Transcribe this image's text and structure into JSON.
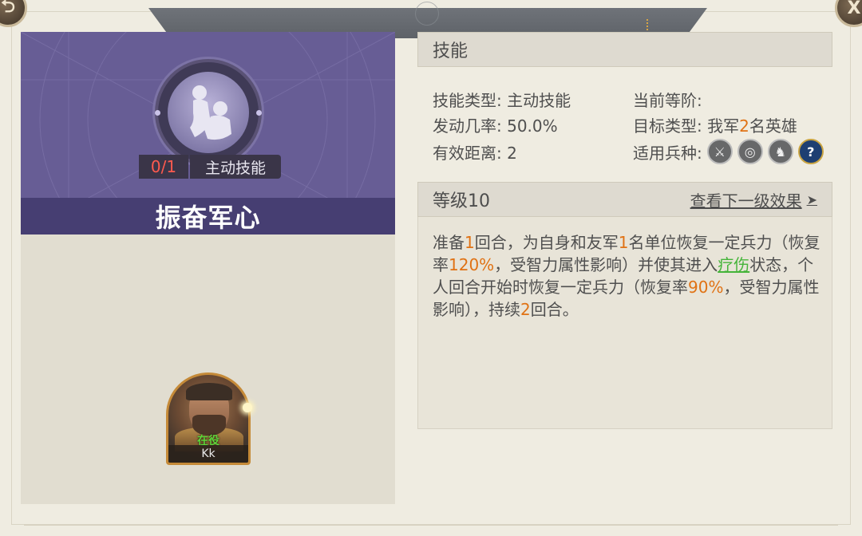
{
  "window": {
    "back_icon": "return-icon",
    "close_label": "X"
  },
  "skill": {
    "count": "0/1",
    "kind": "主动技能",
    "name": "振奋军心",
    "portrait_icon": "healing-embrace-icon"
  },
  "hero": {
    "status": "在役",
    "name": "Kk"
  },
  "info": {
    "section_title": "技能",
    "type_label": "技能类型:",
    "type_value": "主动技能",
    "rank_label": "当前等阶:",
    "rank_value": "",
    "rate_label": "发动几率:",
    "rate_value": "50.0%",
    "target_label": "目标类型:",
    "target_prefix": "我军",
    "target_num": "2",
    "target_suffix": "名英雄",
    "range_label": "有效距离:",
    "range_value": "2",
    "troop_label": "适用兵种:",
    "troop_icons": [
      "sword-icon",
      "bow-target-icon",
      "horse-icon",
      "question-icon"
    ]
  },
  "level": {
    "title": "等级10",
    "next_label": "查看下一级效果",
    "next_arrow": "➤"
  },
  "description": {
    "p1": "准备",
    "n1": "1",
    "p2": "回合，为自身和友军",
    "n2": "1",
    "p3": "名单位恢复一定兵力（恢复率",
    "n3": "120%",
    "p4": "，受智力属性影响）并使其进入",
    "status": "疗伤",
    "p5": "状态，个人回合开始时恢复一定兵力（恢复率",
    "n4": "90%",
    "p6": "，受智力属性影响），持续",
    "n5": "2",
    "p7": "回合。"
  },
  "colors": {
    "header_purple": "#675d95",
    "name_bar": "#463e72",
    "highlight_orange": "#e07214",
    "highlight_green": "#45b43a",
    "count_red": "#ff5a4e"
  }
}
